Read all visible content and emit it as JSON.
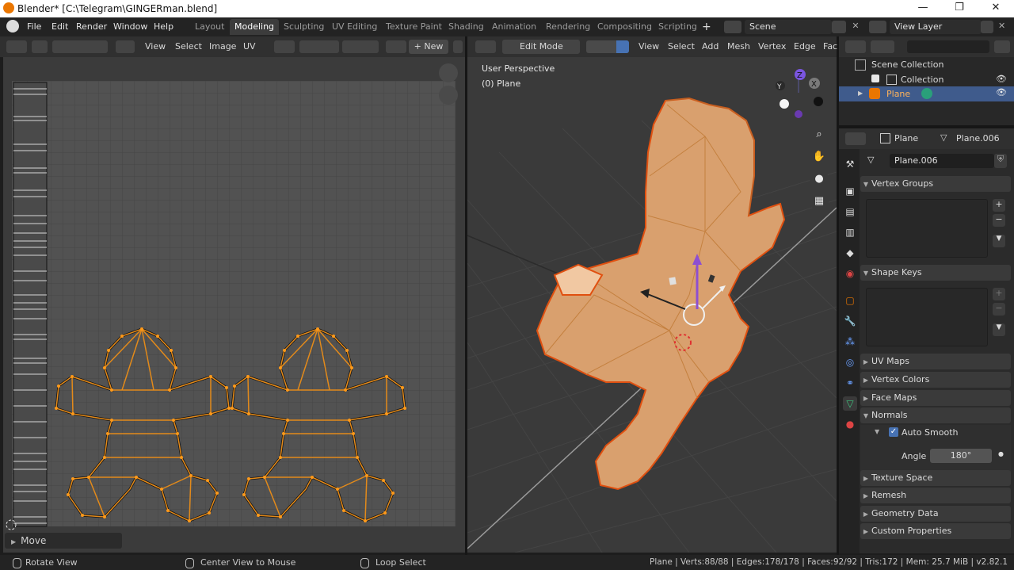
{
  "window": {
    "title": "Blender* [C:\\Telegram\\GINGERman.blend]",
    "controls": [
      "—",
      "❐",
      "✕"
    ]
  },
  "menu": {
    "items": [
      "File",
      "Edit",
      "Render",
      "Window",
      "Help"
    ]
  },
  "workspaces": {
    "tabs": [
      "Layout",
      "Modeling",
      "Sculpting",
      "UV Editing",
      "Texture Paint",
      "Shading",
      "Animation",
      "Rendering",
      "Compositing",
      "Scripting"
    ],
    "active": "Modeling",
    "add": "+"
  },
  "scene": {
    "name": "Scene",
    "view_layer": "View Layer"
  },
  "uv_editor": {
    "menus": [
      "View",
      "Select",
      "Image",
      "UV"
    ],
    "new_button": "New",
    "last_operator": "Move",
    "zoom_icon": "zoom-icon",
    "pan_icon": "hand-icon"
  },
  "viewport": {
    "mode": "Edit Mode",
    "menus": [
      "View",
      "Select",
      "Add",
      "Mesh",
      "Vertex",
      "Edge",
      "Fac"
    ],
    "perspective_label": "User Perspective",
    "object_label": "(0) Plane",
    "axis_labels": {
      "z": "Z",
      "x": "X",
      "y": "Y"
    }
  },
  "outliner": {
    "scene_collection": "Scene Collection",
    "collection": "Collection",
    "selected_object": "Plane"
  },
  "properties": {
    "object_name": "Plane",
    "mesh_name": "Plane.006",
    "data_field": "Plane.006",
    "panels": {
      "vertex_groups": "Vertex Groups",
      "shape_keys": "Shape Keys",
      "uv_maps": "UV Maps",
      "vertex_colors": "Vertex Colors",
      "face_maps": "Face Maps",
      "normals": "Normals",
      "auto_smooth": "Auto Smooth",
      "angle_label": "Angle",
      "angle_value": "180°",
      "texture_space": "Texture Space",
      "remesh": "Remesh",
      "geometry_data": "Geometry Data",
      "custom_properties": "Custom Properties"
    },
    "auto_smooth_checked": true
  },
  "status_bar": {
    "left": "Rotate View",
    "middle": "Center View to Mouse",
    "right": "Loop Select",
    "stats": "Plane | Verts:88/88 | Edges:178/178 | Faces:92/92 | Tris:172 | Mem: 25.7 MiB | v2.82.1"
  },
  "colors": {
    "accent": "#ea7600",
    "selected_row": "#3f5b8c",
    "mesh_fill": "#d9a06e",
    "mesh_edge": "#e05010"
  }
}
